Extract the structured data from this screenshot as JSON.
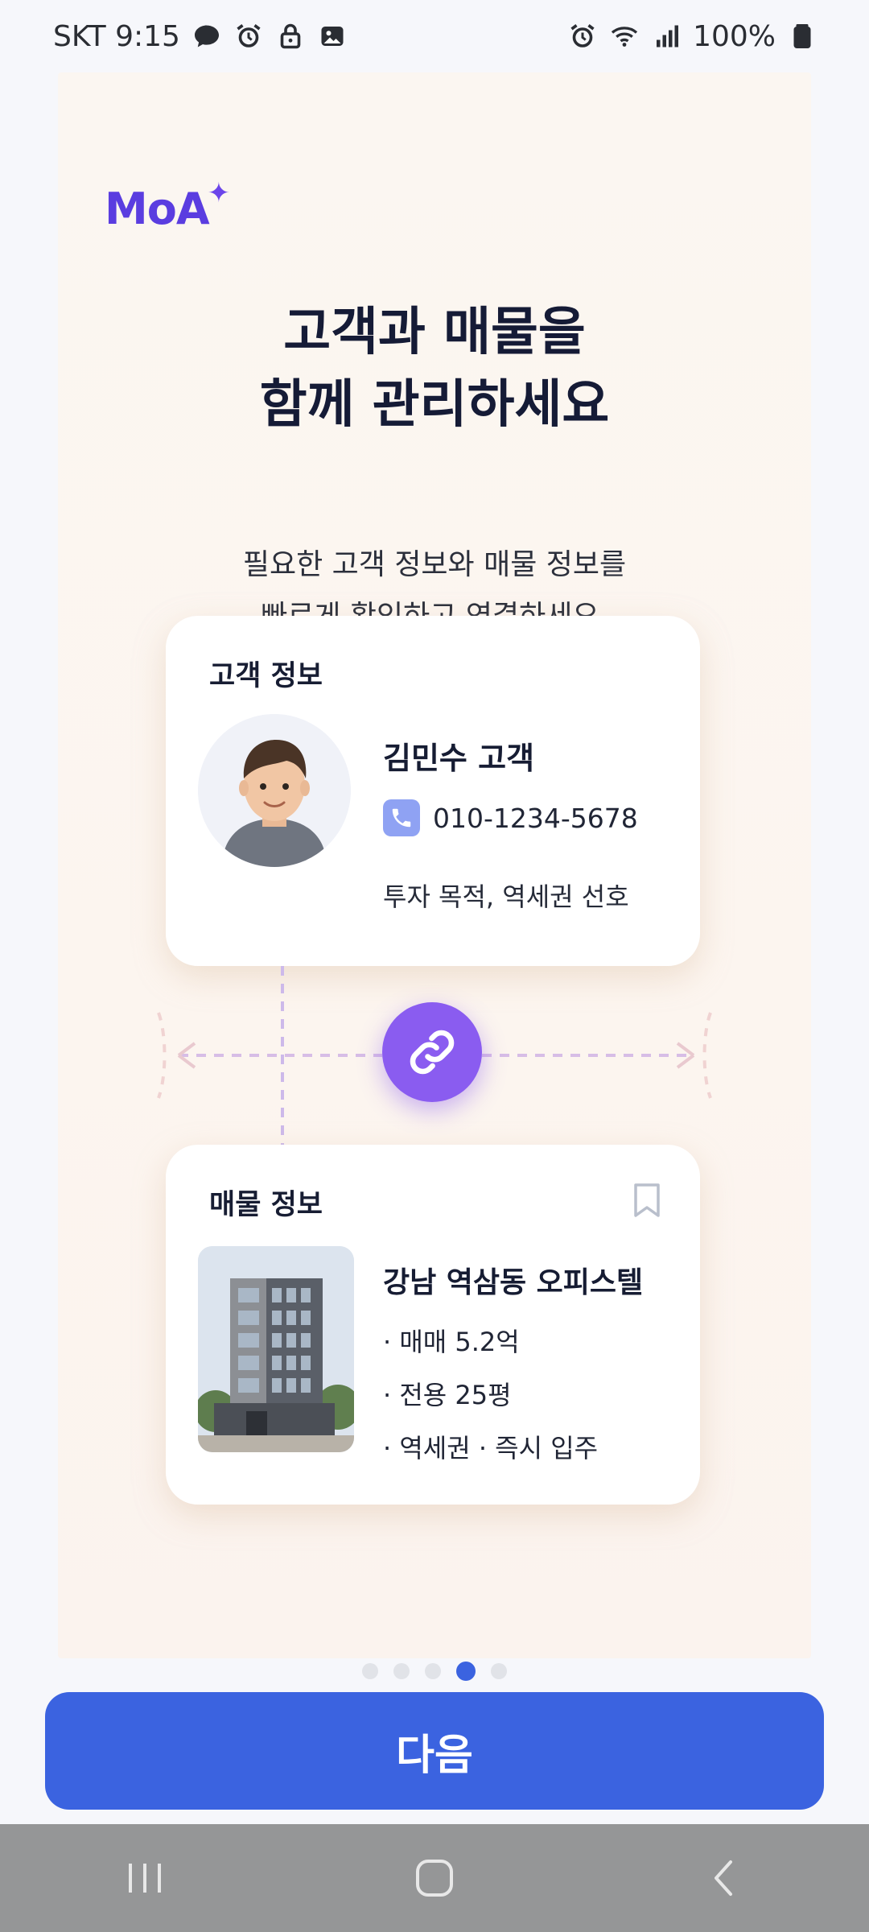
{
  "status_bar": {
    "carrier_time": "SKT 9:15",
    "battery": "100%",
    "left_icons": [
      "chat-bubble-icon",
      "alarm-icon",
      "lock-icon",
      "image-icon"
    ],
    "right_icons": [
      "alarm-icon",
      "wifi-icon",
      "signal-icon",
      "battery-icon"
    ]
  },
  "onboarding": {
    "logo": "MoA",
    "title": "고객과 매물을\n함께 관리하세요",
    "subtitle": "필요한 고객 정보와 매물 정보를\n빠르게 확인하고 연결하세요.",
    "customer_card": {
      "title": "고객 정보",
      "name": "김민수 고객",
      "phone": "010-1234-5678",
      "note": "투자 목적, 역세권 선호"
    },
    "link_icon": "link-icon",
    "property_card": {
      "title": "매물 정보",
      "name": "강남 역삼동 오피스텔",
      "lines": [
        "· 매매 5.2억",
        "· 전용 25평",
        "· 역세권 · 즉시 입주"
      ]
    },
    "pagination": {
      "total": 5,
      "current": 4
    },
    "next_label": "다음"
  },
  "colors": {
    "brand": "#5a3de0",
    "primary_button": "#3b63e0",
    "link_circle": "#8a5cf0"
  },
  "nav_bar": {
    "icons": [
      "recent-apps-icon",
      "home-icon",
      "back-icon"
    ]
  }
}
